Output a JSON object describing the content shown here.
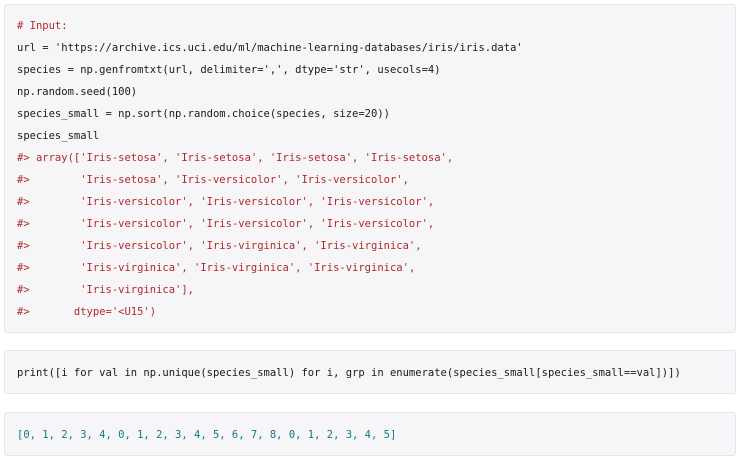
{
  "block1": {
    "lines": [
      "# Input:",
      "url = 'https://archive.ics.uci.edu/ml/machine-learning-databases/iris/iris.data'",
      "species = np.genfromtxt(url, delimiter=',', dtype='str', usecols=4)",
      "np.random.seed(100)",
      "species_small = np.sort(np.random.choice(species, size=20))",
      "species_small",
      "#> array(['Iris-setosa', 'Iris-setosa', 'Iris-setosa', 'Iris-setosa',",
      "#>        'Iris-setosa', 'Iris-versicolor', 'Iris-versicolor',",
      "#>        'Iris-versicolor', 'Iris-versicolor', 'Iris-versicolor',",
      "#>        'Iris-versicolor', 'Iris-versicolor', 'Iris-versicolor',",
      "#>        'Iris-versicolor', 'Iris-virginica', 'Iris-virginica',",
      "#>        'Iris-virginica', 'Iris-virginica', 'Iris-virginica',",
      "#>        'Iris-virginica'],",
      "#>       dtype='<U15')"
    ]
  },
  "block2": {
    "line": "print([i for val in np.unique(species_small) for i, grp in enumerate(species_small[species_small==val])])"
  },
  "block3": {
    "line": "[0, 1, 2, 3, 4, 0, 1, 2, 3, 4, 5, 6, 7, 8, 0, 1, 2, 3, 4, 5]"
  },
  "colors": {
    "block_background": "#f6f6f8",
    "comment": "#b0292c",
    "string": "#0d7a8a",
    "text": "#1a1a1a"
  }
}
